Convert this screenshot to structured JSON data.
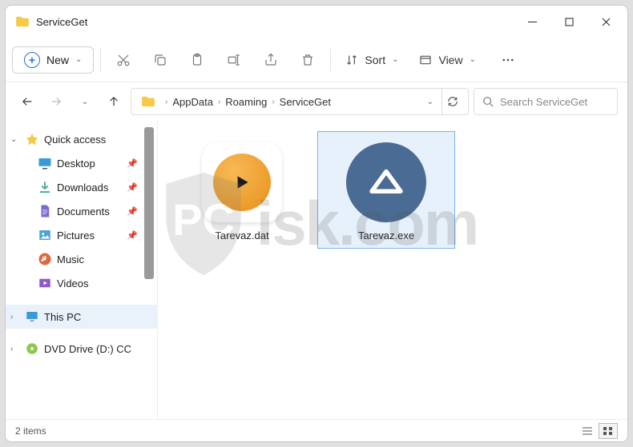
{
  "window": {
    "title": "ServiceGet"
  },
  "toolbar": {
    "new_label": "New",
    "sort_label": "Sort",
    "view_label": "View"
  },
  "breadcrumb": {
    "items": [
      "AppData",
      "Roaming",
      "ServiceGet"
    ]
  },
  "search": {
    "placeholder": "Search ServiceGet"
  },
  "sidebar": {
    "quick_access": "Quick access",
    "items": [
      {
        "label": "Desktop",
        "pinned": true
      },
      {
        "label": "Downloads",
        "pinned": true
      },
      {
        "label": "Documents",
        "pinned": true
      },
      {
        "label": "Pictures",
        "pinned": true
      },
      {
        "label": "Music",
        "pinned": false
      },
      {
        "label": "Videos",
        "pinned": false
      }
    ],
    "this_pc": "This PC",
    "dvd": "DVD Drive (D:) CC"
  },
  "files": [
    {
      "name": "Tarevaz.dat",
      "selected": false
    },
    {
      "name": "Tarevaz.exe",
      "selected": true
    }
  ],
  "status": {
    "count_text": "2 items"
  },
  "watermark": {
    "text": "isk.com"
  }
}
